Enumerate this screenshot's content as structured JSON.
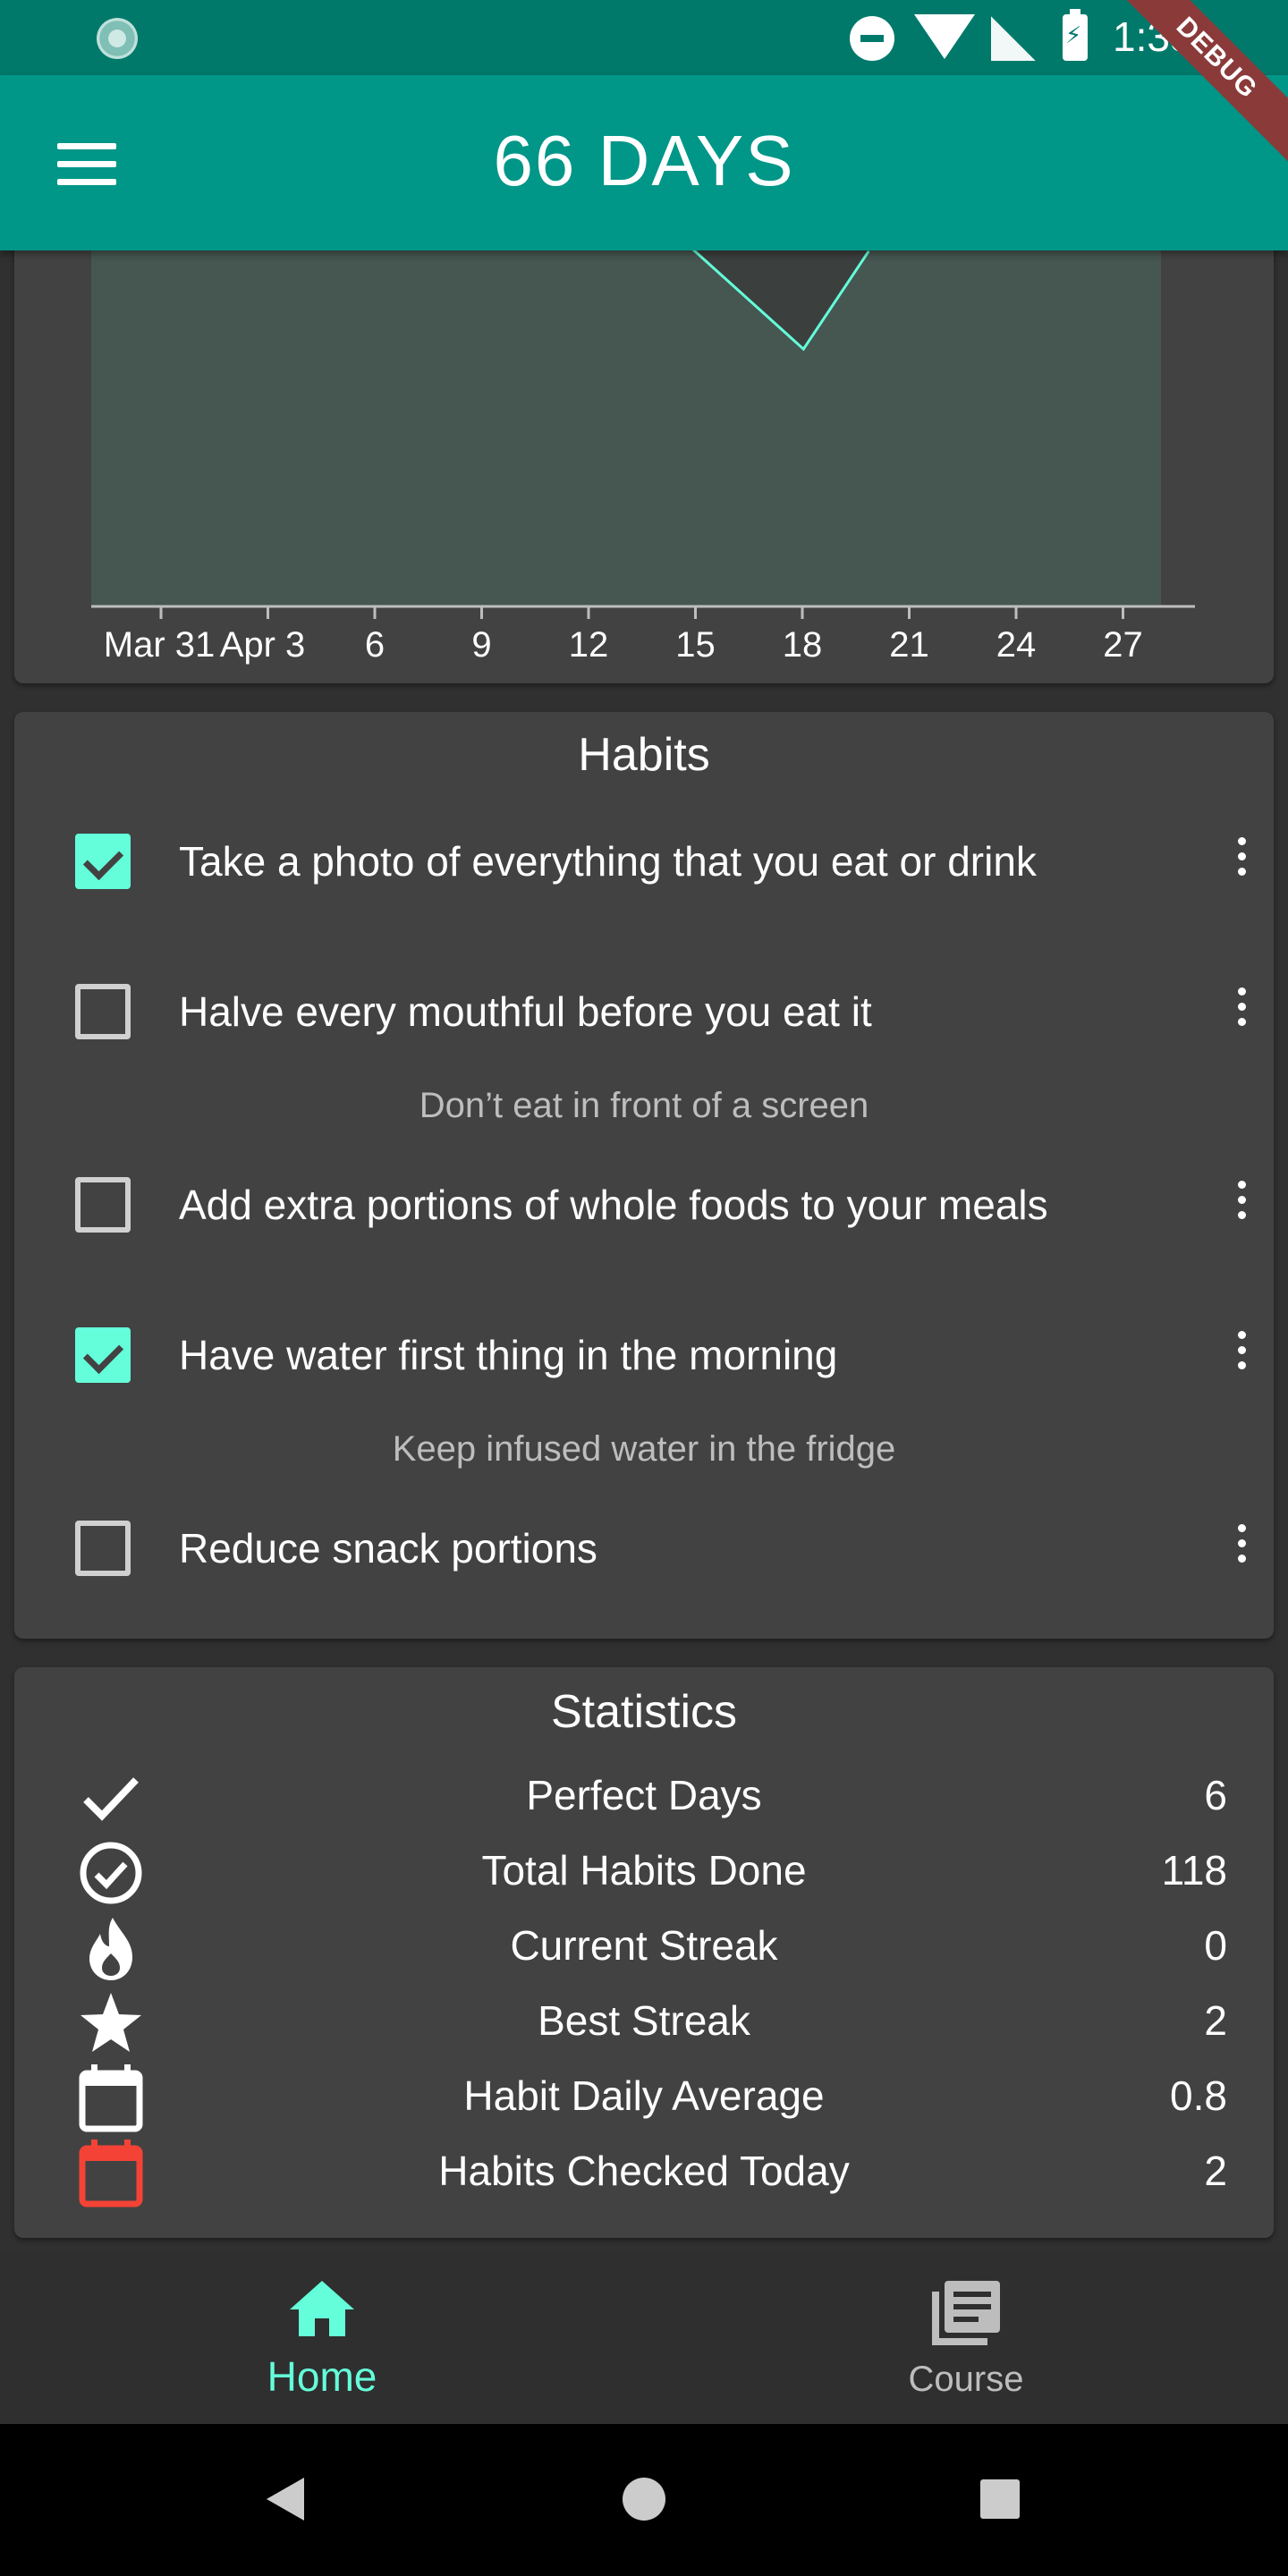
{
  "status_bar": {
    "time": "1:33",
    "debug_label": "DEBUG"
  },
  "app_bar": {
    "title": "66  DAYS"
  },
  "chart_data": {
    "type": "line",
    "x_ticks": [
      "Mar 31",
      "Apr 3",
      "6",
      "9",
      "12",
      "15",
      "18",
      "21",
      "24",
      "27"
    ],
    "series": [
      {
        "x": [
          "Apr 15",
          "Apr 18",
          "Apr 20"
        ],
        "y": [
          null,
          null,
          null
        ]
      }
    ],
    "colors": {
      "line": "#64ffda",
      "area": "#465651"
    }
  },
  "habits": {
    "title": "Habits",
    "items": [
      {
        "label": "Take a photo of everything that you eat or drink",
        "checked": true,
        "note": ""
      },
      {
        "label": "Halve every mouthful before you eat it",
        "checked": false,
        "note": "Don’t eat in front of a screen"
      },
      {
        "label": "Add extra portions of whole foods to your meals",
        "checked": false,
        "note": ""
      },
      {
        "label": "Have water first thing in the morning",
        "checked": true,
        "note": "Keep infused water in the fridge"
      },
      {
        "label": "Reduce snack portions",
        "checked": false,
        "note": ""
      }
    ]
  },
  "statistics": {
    "title": "Statistics",
    "items": [
      {
        "icon": "check-icon",
        "label": "Perfect Days",
        "value": "6"
      },
      {
        "icon": "check-circle-icon",
        "label": "Total Habits Done",
        "value": "118"
      },
      {
        "icon": "flame-icon",
        "label": "Current Streak",
        "value": "0"
      },
      {
        "icon": "star-icon",
        "label": "Best Streak",
        "value": "2"
      },
      {
        "icon": "calendar-icon",
        "label": "Habit Daily Average",
        "value": "0.8"
      },
      {
        "icon": "calendar-today-icon",
        "label": "Habits Checked Today",
        "value": "2"
      }
    ]
  },
  "bottom_nav": {
    "home": {
      "label": "Home",
      "icon": "home-icon",
      "active": true
    },
    "course": {
      "label": "Course",
      "icon": "library-books-icon",
      "active": false
    }
  },
  "colors": {
    "accent": "#64ffda",
    "app_bar": "#009688",
    "status_bar": "#00796b",
    "card": "#424242",
    "alert": "#f44336"
  }
}
